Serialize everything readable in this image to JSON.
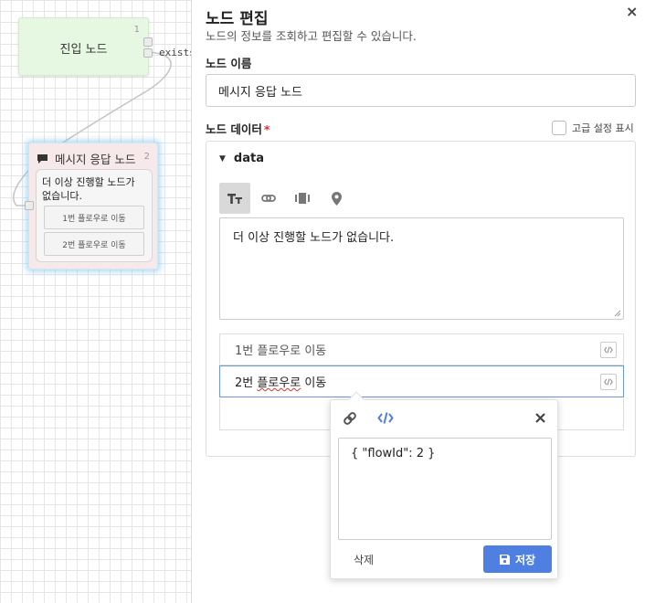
{
  "canvas": {
    "entry_node": {
      "title": "진입 노드",
      "number": "1",
      "port_label": "exists"
    },
    "message_node": {
      "title": "메시지 응답 노드",
      "number": "2",
      "text": "더 이상 진행할 노드가 없습니다.",
      "buttons": [
        "1번 플로우로 이동",
        "2번 플로우로 이동"
      ]
    }
  },
  "panel": {
    "title": "노드 편집",
    "subtitle": "노드의 정보를 조회하고 편집할 수 있습니다.",
    "close_icon": "×",
    "name_label": "노드 이름",
    "name_value": "메시지 응답 노드",
    "data_label": "노드 데이터",
    "required_mark": "*",
    "advanced_label": "고급 설정 표시",
    "data_section": "data",
    "tabs": [
      "text-icon",
      "link-icon",
      "carousel-icon",
      "location-icon"
    ],
    "message_text": "더 이상 진행할 노드가 없습니다.",
    "quick_replies": [
      {
        "pre": "1번 플로우로 이동",
        "spell": "",
        "post": ""
      },
      {
        "pre": "2번 ",
        "spell": "플로우로",
        "post": " 이동"
      }
    ]
  },
  "popover": {
    "code_value": "{ \"flowId\": 2 }",
    "delete_label": "삭제",
    "save_label": "저장"
  },
  "colors": {
    "accent": "#4f7fe0",
    "entry_node": "#e6f7e2",
    "message_node": "#f7e8ea",
    "focus": "#6a9ad6"
  }
}
